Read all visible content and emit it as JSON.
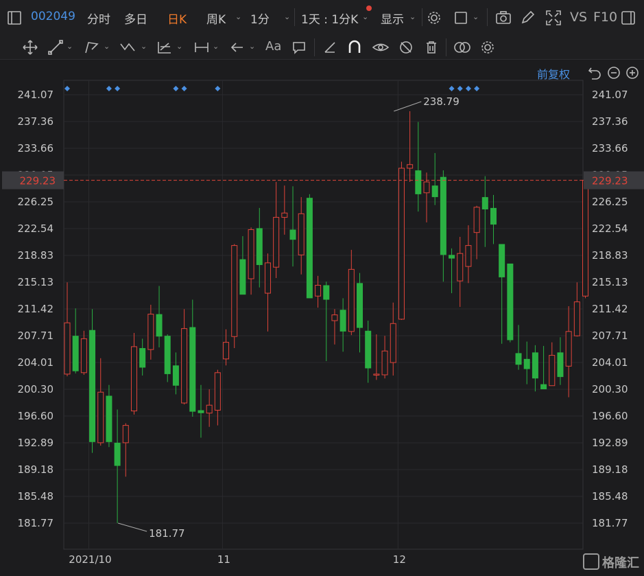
{
  "toolbar": {
    "code": "002049",
    "tabs": [
      "分时",
      "多日",
      "日K",
      "周K",
      "1分"
    ],
    "active_tab": "日K",
    "period": "1天 : 1分K",
    "display": "显示",
    "vs": "VS",
    "f10": "F10",
    "font_button": "Aa"
  },
  "adjust_label": "前复权",
  "logo": "格隆汇",
  "chart_data": {
    "type": "candlestick",
    "ylim": [
      178.06,
      244.78
    ],
    "yticks": [
      "241.07",
      "237.36",
      "233.66",
      "229.95",
      "226.25",
      "222.54",
      "218.83",
      "215.13",
      "211.42",
      "207.71",
      "204.01",
      "200.30",
      "196.60",
      "192.89",
      "189.18",
      "185.48",
      "181.77"
    ],
    "current_price": "229.23",
    "current_color": "#e0443a",
    "up_color": "#e0443a",
    "down_color": "#2bb143",
    "xlabels": [
      {
        "label": "2021/10",
        "index": 3
      },
      {
        "label": "11",
        "index": 19
      },
      {
        "label": "12",
        "index": 40
      }
    ],
    "high_label": {
      "text": "238.79",
      "index": 39,
      "value": 238.79
    },
    "low_label": {
      "text": "181.77",
      "index": 6,
      "value": 181.77
    },
    "marker_color": "#4a90e2",
    "markers": [
      0,
      5,
      6,
      13,
      14,
      18,
      46,
      47,
      48,
      49
    ],
    "candles": [
      {
        "o": 202.4,
        "h": 215.1,
        "l": 202.1,
        "c": 209.5
      },
      {
        "o": 207.7,
        "h": 211.5,
        "l": 202.5,
        "c": 202.8
      },
      {
        "o": 202.6,
        "h": 208.4,
        "l": 202.3,
        "c": 207.3
      },
      {
        "o": 208.5,
        "h": 211.4,
        "l": 191.5,
        "c": 193.0
      },
      {
        "o": 192.9,
        "h": 204.6,
        "l": 192.5,
        "c": 199.9
      },
      {
        "o": 199.4,
        "h": 200.9,
        "l": 192.3,
        "c": 193.0
      },
      {
        "o": 192.9,
        "h": 197.5,
        "l": 181.77,
        "c": 189.7
      },
      {
        "o": 192.9,
        "h": 195.6,
        "l": 188.2,
        "c": 195.3
      },
      {
        "o": 197.3,
        "h": 208.1,
        "l": 196.8,
        "c": 206.2
      },
      {
        "o": 206.0,
        "h": 207.3,
        "l": 202.2,
        "c": 203.3
      },
      {
        "o": 205.8,
        "h": 212.0,
        "l": 204.4,
        "c": 210.7
      },
      {
        "o": 210.7,
        "h": 214.6,
        "l": 206.1,
        "c": 207.6
      },
      {
        "o": 207.7,
        "h": 207.9,
        "l": 201.3,
        "c": 202.4
      },
      {
        "o": 203.6,
        "h": 205.4,
        "l": 199.6,
        "c": 200.8
      },
      {
        "o": 198.4,
        "h": 211.4,
        "l": 198.2,
        "c": 208.7
      },
      {
        "o": 208.9,
        "h": 212.7,
        "l": 196.5,
        "c": 197.2
      },
      {
        "o": 197.4,
        "h": 200.9,
        "l": 193.6,
        "c": 197.0
      },
      {
        "o": 197.0,
        "h": 200.3,
        "l": 195.1,
        "c": 198.1
      },
      {
        "o": 197.4,
        "h": 203.0,
        "l": 195.3,
        "c": 202.6
      },
      {
        "o": 204.5,
        "h": 208.6,
        "l": 203.6,
        "c": 206.8
      },
      {
        "o": 207.6,
        "h": 220.4,
        "l": 206.0,
        "c": 220.2
      },
      {
        "o": 218.3,
        "h": 221.5,
        "l": 213.8,
        "c": 213.4
      },
      {
        "o": 215.6,
        "h": 222.7,
        "l": 213.4,
        "c": 222.4
      },
      {
        "o": 222.6,
        "h": 225.4,
        "l": 214.4,
        "c": 217.5
      },
      {
        "o": 213.6,
        "h": 219.1,
        "l": 208.3,
        "c": 217.8
      },
      {
        "o": 217.2,
        "h": 229.0,
        "l": 215.7,
        "c": 224.1
      },
      {
        "o": 224.1,
        "h": 228.5,
        "l": 221.7,
        "c": 224.7
      },
      {
        "o": 222.4,
        "h": 228.4,
        "l": 217.3,
        "c": 221.0
      },
      {
        "o": 218.9,
        "h": 226.9,
        "l": 216.2,
        "c": 224.6
      },
      {
        "o": 226.8,
        "h": 227.3,
        "l": 214.9,
        "c": 212.9
      },
      {
        "o": 213.2,
        "h": 216.0,
        "l": 211.6,
        "c": 214.7
      },
      {
        "o": 214.7,
        "h": 215.2,
        "l": 204.2,
        "c": 212.7
      },
      {
        "o": 209.8,
        "h": 211.4,
        "l": 206.5,
        "c": 210.6
      },
      {
        "o": 211.3,
        "h": 212.9,
        "l": 205.5,
        "c": 208.3
      },
      {
        "o": 208.3,
        "h": 219.6,
        "l": 207.8,
        "c": 216.9
      },
      {
        "o": 215.0,
        "h": 216.4,
        "l": 205.4,
        "c": 208.8
      },
      {
        "o": 208.4,
        "h": 209.8,
        "l": 201.2,
        "c": 203.2
      },
      {
        "o": 202.3,
        "h": 207.9,
        "l": 201.6,
        "c": 202.4
      },
      {
        "o": 202.3,
        "h": 207.7,
        "l": 201.8,
        "c": 205.6
      },
      {
        "o": 204.0,
        "h": 212.3,
        "l": 202.2,
        "c": 209.4
      },
      {
        "o": 210.0,
        "h": 231.8,
        "l": 209.9,
        "c": 230.9
      },
      {
        "o": 230.9,
        "h": 238.79,
        "l": 229.0,
        "c": 231.4
      },
      {
        "o": 230.6,
        "h": 237.3,
        "l": 224.9,
        "c": 227.3
      },
      {
        "o": 227.5,
        "h": 230.3,
        "l": 223.4,
        "c": 229.0
      },
      {
        "o": 228.5,
        "h": 233.0,
        "l": 225.8,
        "c": 226.9
      },
      {
        "o": 229.7,
        "h": 230.6,
        "l": 215.2,
        "c": 218.9
      },
      {
        "o": 218.9,
        "h": 219.8,
        "l": 213.6,
        "c": 218.4
      },
      {
        "o": 215.3,
        "h": 221.4,
        "l": 211.7,
        "c": 219.1
      },
      {
        "o": 217.3,
        "h": 223.0,
        "l": 215.0,
        "c": 220.2
      },
      {
        "o": 222.0,
        "h": 225.7,
        "l": 218.3,
        "c": 225.5
      },
      {
        "o": 226.9,
        "h": 229.8,
        "l": 220.0,
        "c": 225.2
      },
      {
        "o": 225.4,
        "h": 227.2,
        "l": 220.4,
        "c": 223.1
      },
      {
        "o": 220.4,
        "h": 220.2,
        "l": 206.6,
        "c": 215.8
      },
      {
        "o": 217.7,
        "h": 217.4,
        "l": 206.8,
        "c": 207.1
      },
      {
        "o": 205.3,
        "h": 209.2,
        "l": 203.0,
        "c": 203.7
      },
      {
        "o": 204.5,
        "h": 206.9,
        "l": 201.0,
        "c": 203.1
      },
      {
        "o": 205.4,
        "h": 206.4,
        "l": 200.0,
        "c": 201.8
      },
      {
        "o": 201.0,
        "h": 206.3,
        "l": 200.6,
        "c": 200.3
      },
      {
        "o": 200.8,
        "h": 206.8,
        "l": 201.2,
        "c": 205.0
      },
      {
        "o": 205.4,
        "h": 207.5,
        "l": 200.9,
        "c": 202.0
      },
      {
        "o": 203.5,
        "h": 211.8,
        "l": 199.2,
        "c": 208.3
      },
      {
        "o": 207.7,
        "h": 215.1,
        "l": 207.6,
        "c": 212.4
      },
      {
        "o": 213.2,
        "h": 229.3,
        "l": 212.9,
        "c": 229.23
      }
    ]
  }
}
